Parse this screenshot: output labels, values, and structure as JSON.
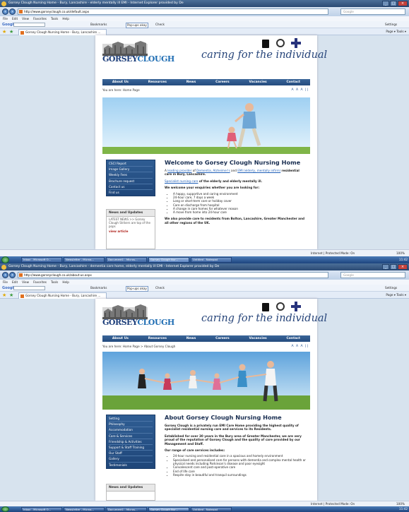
{
  "browser": {
    "menu": [
      "File",
      "Edit",
      "View",
      "Favorites",
      "Tools",
      "Help"
    ],
    "google_label": "Google",
    "bookmarks": "Bookmarks",
    "popups": "Pop-ups okay",
    "check": "Check",
    "settings": "Settings",
    "search_placeholder": "Google",
    "cmd": "Page ▾  Tools ▾",
    "status": "Internet | Protected Mode: On",
    "zoom": "100%"
  },
  "taskbar": {
    "items": [
      "Inbox - Microsoft O...",
      "Newsletter - Micros...",
      "Document1 - Micros...",
      "Gorsey Clough Nur...",
      "Untitled - Notepad"
    ],
    "clock": "11:42"
  },
  "site": {
    "logo_word1": "GORSEY",
    "logo_word2": "CLOUGH",
    "tagline": "caring for the individual",
    "nav": [
      "About Us",
      "Resources",
      "News",
      "Careers",
      "Vacancies",
      "Contact"
    ],
    "textsize": "A A A ||"
  },
  "shot1": {
    "window_title": "Gorsey Clough Nursing Home - Bury, Lancashire - elderly mentally ill EMI - Internet Explorer provided by De",
    "url": "http://www.gorseyclough.co.uk/default.aspx",
    "tab": "Gorsey Clough Nursing Home - Bury, Lancashire ...",
    "breadcrumb": "You are here: Home Page",
    "side_menu": [
      "CSCI Report",
      "Image Gallery",
      "Weekly Fees",
      "Brochure request",
      "Contact us",
      "Find us"
    ],
    "news_title": "News and Updates",
    "news_text": "LATEST NEWS >> Gorsey Clough Strikers are top of the pops",
    "news_link": "view article",
    "heading": "Welcome to Gorsey Clough Nursing Home",
    "intro_pre": "A",
    "intro_link1": "leading provider",
    "intro_mid1": "of",
    "intro_link2": "Dementia, Alzheimer's",
    "intro_mid2": "and",
    "intro_link3": "EMI (elderly, mentally infirm)",
    "intro_post": "residential care in Bury, Lancashire.",
    "spec_link": "Specialist nursing care",
    "spec_post": "of the elderly and elderly mentally ill.",
    "welcome": "We welcome your enquiries whether you are looking for:",
    "list": [
      "A happy, supportive and caring environment",
      "24-hour care, 7 days a week",
      "Long or short-term care or holiday cover",
      "Care on discharge from hospital",
      "A change in care homes for whatever reason",
      "A move from home into 24-hour care"
    ],
    "closing": "We also provide care to residents from Bolton, Lancashire, Greater Manchester and all other regions of the UK."
  },
  "shot2": {
    "window_title": "Gorsey Clough Nursing Home - Bury, Lancashire - dementia care home, elderly mentally ill EMI - Internet Explorer provided by De",
    "url": "http://www.gorseyclough.co.uk/about-us.aspx",
    "tab": "Gorsey Clough Nursing Home - Bury, Lancashire ...",
    "breadcrumb": "You are here: Home Page > About Gorsey Clough",
    "side_menu": [
      "Setting",
      "Philosophy",
      "Accommodation",
      "Care & Services",
      "Friendship & Activities",
      "Support & Staff Training",
      "Our Staff",
      "Gallery",
      "Testimonials"
    ],
    "news_title": "News and Updates",
    "heading": "About Gorsey Clough Nursing Home",
    "p1": "Gorsey Clough is a privately run EMI Care Home providing the highest quality of specialist residential nursing care and services to its Residents.",
    "p2": "Established for over 30 years in the Bury area of Greater Manchester, we are very proud of the reputation of Gorsey Clough and the quality of care provided by our Management and Staff.",
    "p3": "Our range of care services includes:",
    "list": [
      "24-hour nursing and residential care in a spacious and homely environment",
      "Specialised and personalised care for persons with dementia and complex mental health or physical needs including Parkinson's disease and poor eyesight",
      "Convalescent care and post-operative care",
      "End of life care",
      "Respite stay in beautiful and tranquil surroundings"
    ]
  }
}
